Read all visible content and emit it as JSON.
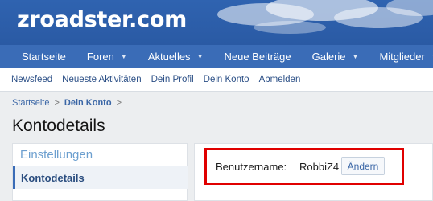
{
  "site": {
    "logo": "zroadster.com"
  },
  "main_nav": [
    {
      "label": "Startseite",
      "dropdown": false
    },
    {
      "label": "Foren",
      "dropdown": true
    },
    {
      "label": "Aktuelles",
      "dropdown": true
    },
    {
      "label": "Neue Beiträge",
      "dropdown": false
    },
    {
      "label": "Galerie",
      "dropdown": true
    },
    {
      "label": "Mitglieder",
      "dropdown": true
    }
  ],
  "sub_nav": [
    "Newsfeed",
    "Neueste Aktivitäten",
    "Dein Profil",
    "Dein Konto",
    "Abmelden"
  ],
  "breadcrumb": {
    "home": "Startseite",
    "current": "Dein Konto"
  },
  "page": {
    "title": "Kontodetails"
  },
  "sidebar": {
    "heading": "Einstellungen",
    "active_item": "Kontodetails"
  },
  "account": {
    "field_label": "Benutzername:",
    "username": "RobbiZ4",
    "change_label": "Ändern"
  },
  "colors": {
    "header_blue": "#2f63b0",
    "nav_blue": "#3a6cb7",
    "link": "#2b4f86",
    "highlight_red": "#e00000"
  }
}
